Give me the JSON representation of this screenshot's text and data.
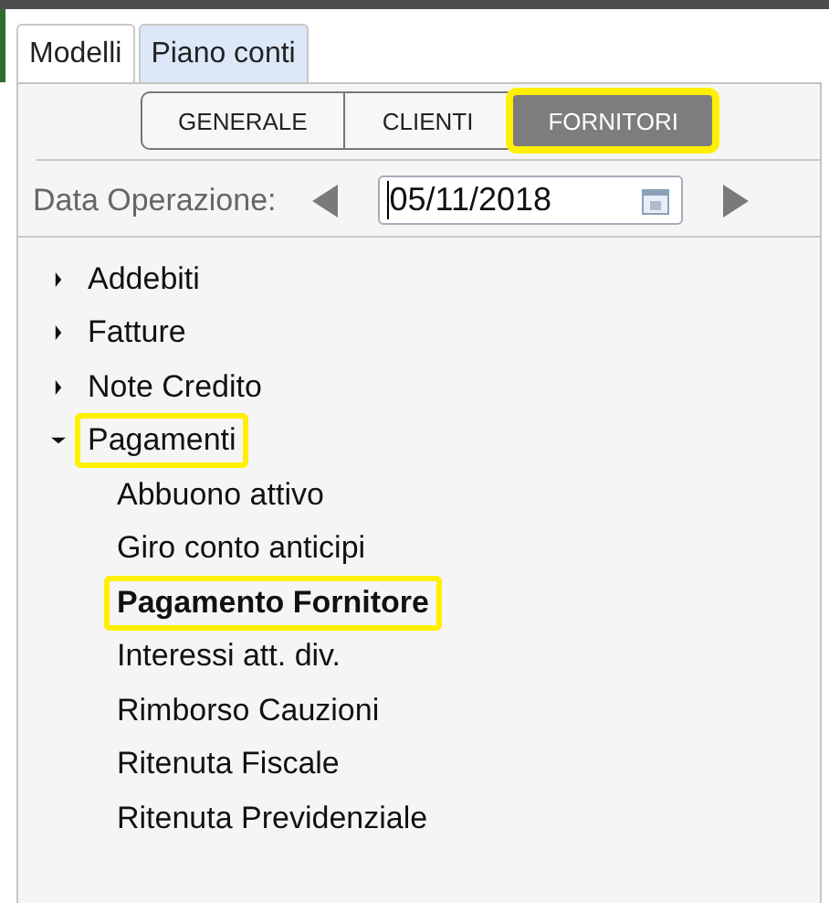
{
  "tabs": [
    {
      "label": "Modelli",
      "selected": true
    },
    {
      "label": "Piano conti",
      "selected": false
    }
  ],
  "segments": [
    {
      "label": "GENERALE",
      "selected": false,
      "highlighted": false
    },
    {
      "label": "CLIENTI",
      "selected": false,
      "highlighted": false
    },
    {
      "label": "FORNITORI",
      "selected": true,
      "highlighted": true
    }
  ],
  "date_row": {
    "label": "Data Operazione:",
    "value": "05/11/2018"
  },
  "tree": [
    {
      "label": "Addebiti",
      "expanded": false,
      "highlighted": false
    },
    {
      "label": "Fatture",
      "expanded": false,
      "highlighted": false
    },
    {
      "label": "Note Credito",
      "expanded": false,
      "highlighted": false
    },
    {
      "label": "Pagamenti",
      "expanded": true,
      "highlighted": true,
      "children": [
        {
          "label": "Abbuono attivo",
          "selected": false,
          "highlighted": false
        },
        {
          "label": "Giro conto anticipi",
          "selected": false,
          "highlighted": false
        },
        {
          "label": "Pagamento Fornitore",
          "selected": true,
          "highlighted": true
        },
        {
          "label": "Interessi att. div.",
          "selected": false,
          "highlighted": false
        },
        {
          "label": "Rimborso Cauzioni",
          "selected": false,
          "highlighted": false
        },
        {
          "label": "Ritenuta Fiscale",
          "selected": false,
          "highlighted": false
        },
        {
          "label": "Ritenuta Previdenziale",
          "selected": false,
          "highlighted": false
        }
      ]
    }
  ]
}
